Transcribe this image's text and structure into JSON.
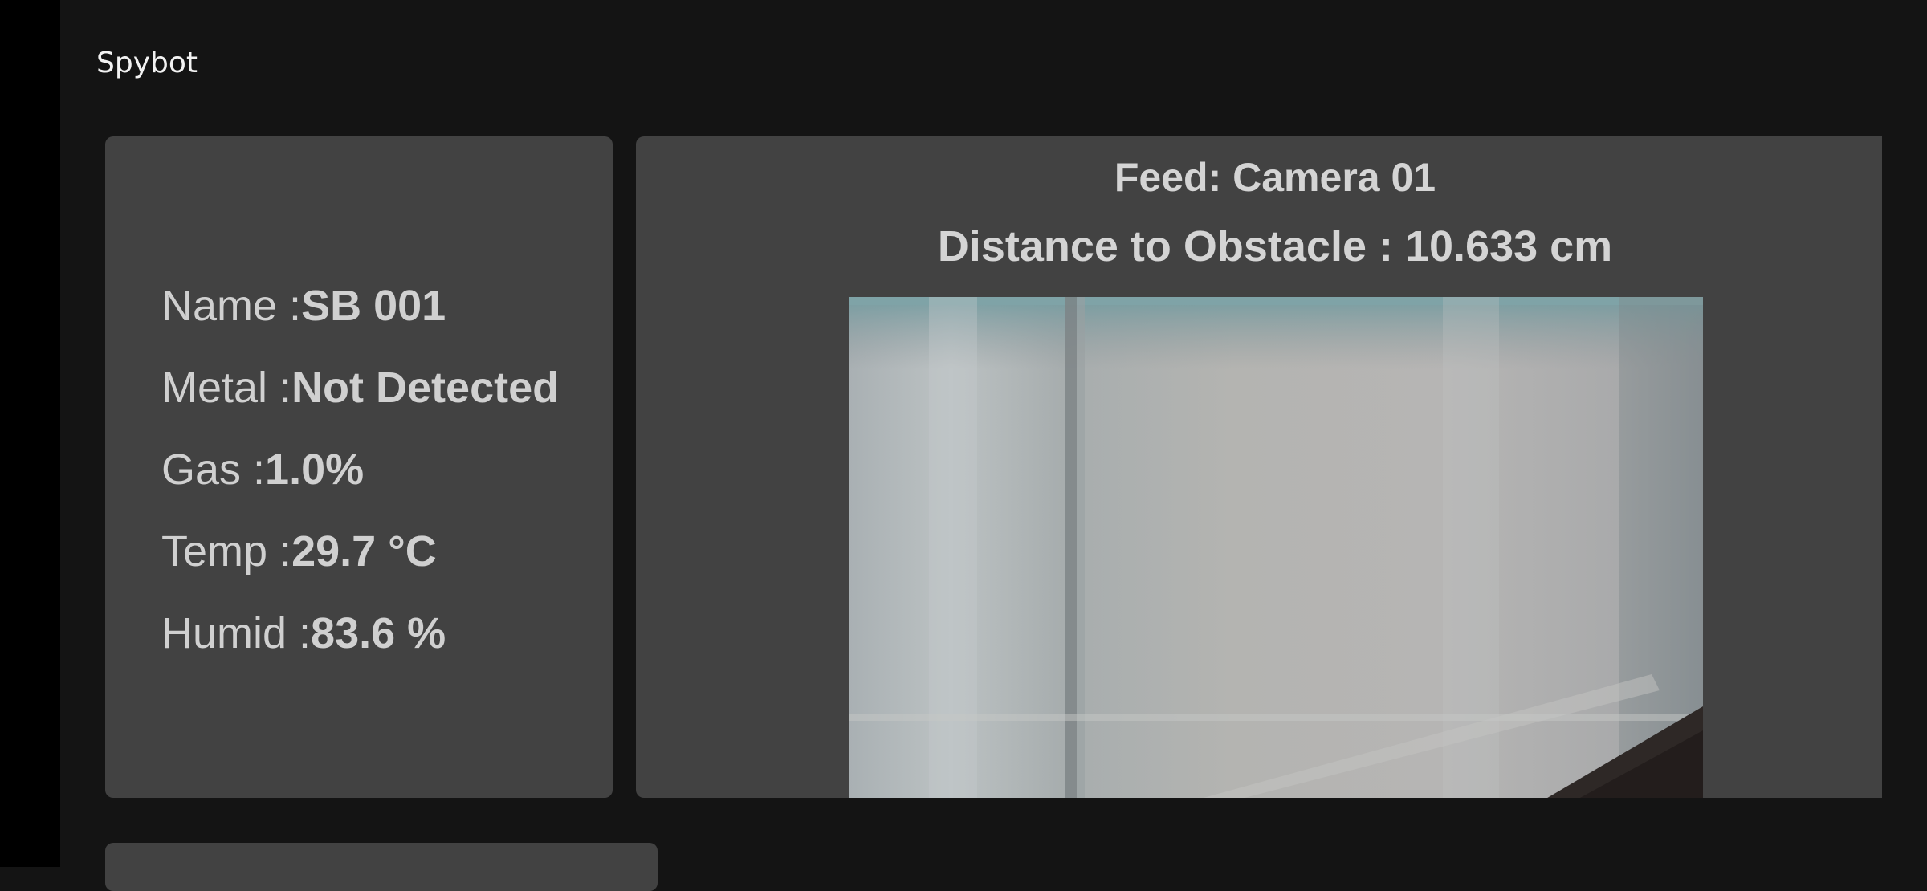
{
  "app": {
    "title": "Spybot"
  },
  "info": {
    "name_label": "Name :",
    "name_value": "SB 001",
    "metal_label": "Metal :",
    "metal_value": "Not Detected",
    "gas_label": "Gas :",
    "gas_value": "1.0%",
    "temp_label": "Temp :",
    "temp_value": "29.7 °C",
    "humid_label": "Humid :",
    "humid_value": "83.6 %"
  },
  "feed": {
    "title": "Feed: Camera 01",
    "distance": "Distance to Obstacle : 10.633 cm"
  },
  "colors": {
    "background": "#141414",
    "card": "#424242",
    "text": "#d0d0d0"
  }
}
